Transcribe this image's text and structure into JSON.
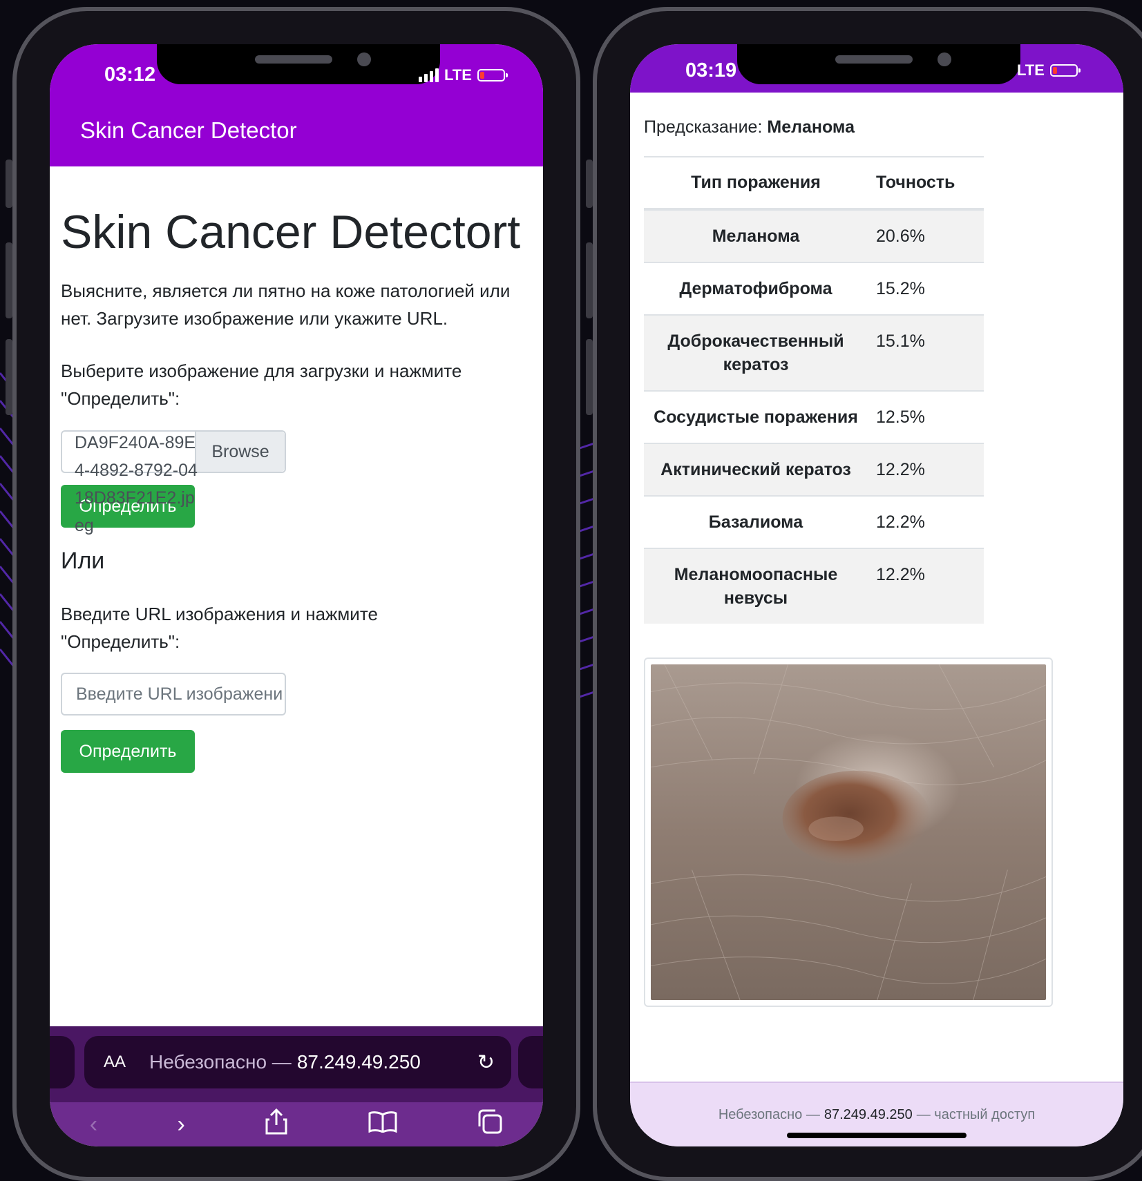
{
  "left_phone": {
    "status": {
      "time": "03:12",
      "network": "LTE"
    },
    "navbar": {
      "brand": "Skin Cancer Detector"
    },
    "main": {
      "title": "Skin Cancer Detectort",
      "intro": "Выясните, является ли пятно на коже патологией или нет. Загрузите изображение или укажите URL.",
      "upload_prompt": "Выберите изображение для загрузки и нажмите \"Определить\":",
      "file_name": "DA9F240A-89E4-4892-8792-0418D83F21E2.jpeg",
      "browse_label": "Browse",
      "detect_button": "Определить",
      "or_heading": "Или",
      "url_prompt": "Введите URL изображения и нажмите \"Определить\":",
      "url_placeholder": "Введите URL изображения",
      "detect_button_2": "Определить"
    },
    "browser": {
      "text_size": "AA",
      "insecure": "Небезопасно —",
      "address": "87.249.49.250"
    }
  },
  "right_phone": {
    "status": {
      "time": "03:19",
      "network": "LTE"
    },
    "prediction": {
      "label": "Предсказание:",
      "value": "Меланома"
    },
    "table": {
      "headers": [
        "Тип поражения",
        "Точность"
      ],
      "rows": [
        {
          "type": "Меланома",
          "accuracy": "20.6%"
        },
        {
          "type": "Дерматофиброма",
          "accuracy": "15.2%"
        },
        {
          "type": "Доброкачественный кератоз",
          "accuracy": "15.1%"
        },
        {
          "type": "Сосудистые поражения",
          "accuracy": "12.5%"
        },
        {
          "type": "Актинический кератоз",
          "accuracy": "12.2%"
        },
        {
          "type": "Базалиома",
          "accuracy": "12.2%"
        },
        {
          "type": "Меланомоопасные невусы",
          "accuracy": "12.2%"
        }
      ]
    },
    "footer": {
      "insecure": "Небезопасно —",
      "address": "87.249.49.250",
      "suffix": "— частный доступ"
    }
  },
  "colors": {
    "app_purple": "#9400d3",
    "success_green": "#28a745",
    "safari_purple": "#6d2c8e",
    "background": "#0b0a12"
  },
  "icons": [
    "signal-icon",
    "battery-icon",
    "reload-icon",
    "back-icon",
    "forward-icon",
    "share-icon",
    "bookmarks-icon",
    "tabs-icon"
  ]
}
